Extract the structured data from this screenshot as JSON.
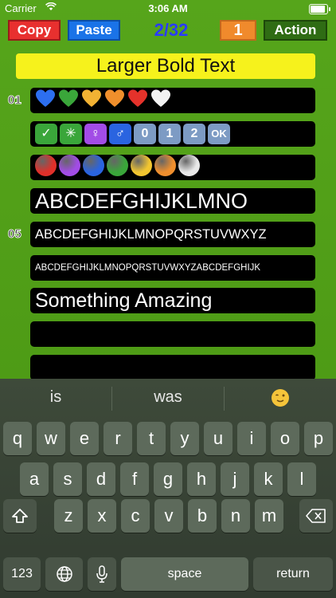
{
  "status": {
    "carrier": "Carrier",
    "time": "3:06 AM"
  },
  "toolbar": {
    "copy": "Copy",
    "paste": "Paste",
    "counter": "2/32",
    "one": "1",
    "action": "Action"
  },
  "banner": "Larger Bold Text",
  "labels": {
    "row1": "01",
    "row5": "05"
  },
  "rows": {
    "numbers": [
      "0",
      "1",
      "2"
    ],
    "ok": "OK",
    "big": "ABCDEFGHIJKLMNO",
    "medium": "ABCDEFGHIJKLMNOPQRSTUVWXYZ",
    "small": "ABCDEFGHIJKLMNOPQRSTUVWXYZABCDEFGHIJK",
    "something": "Something Amazing"
  },
  "colors": {
    "background": "#4f9a17",
    "copy": "#e8302f",
    "paste": "#1a73e8",
    "counter": "#2a3cff",
    "one": "#f08a2c",
    "action": "#2f6c14",
    "banner": "#f6f21c"
  },
  "hearts": [
    "#2d6ff0",
    "#3aa63a",
    "#f2b233",
    "#f08f2c",
    "#e5322b",
    "#f2f2f2"
  ],
  "circles": [
    "#e0302a",
    "#a24ce6",
    "#2a64e0",
    "#3aa63a",
    "#f2c630",
    "#ef8f2e",
    "#e9e9e9"
  ],
  "keyboard": {
    "suggestions": [
      "is",
      "was"
    ],
    "row1": [
      "q",
      "w",
      "e",
      "r",
      "t",
      "y",
      "u",
      "i",
      "o",
      "p"
    ],
    "row2": [
      "a",
      "s",
      "d",
      "f",
      "g",
      "h",
      "j",
      "k",
      "l"
    ],
    "row3": [
      "z",
      "x",
      "c",
      "v",
      "b",
      "n",
      "m"
    ],
    "numbers": "123",
    "space": "space",
    "return": "return"
  }
}
